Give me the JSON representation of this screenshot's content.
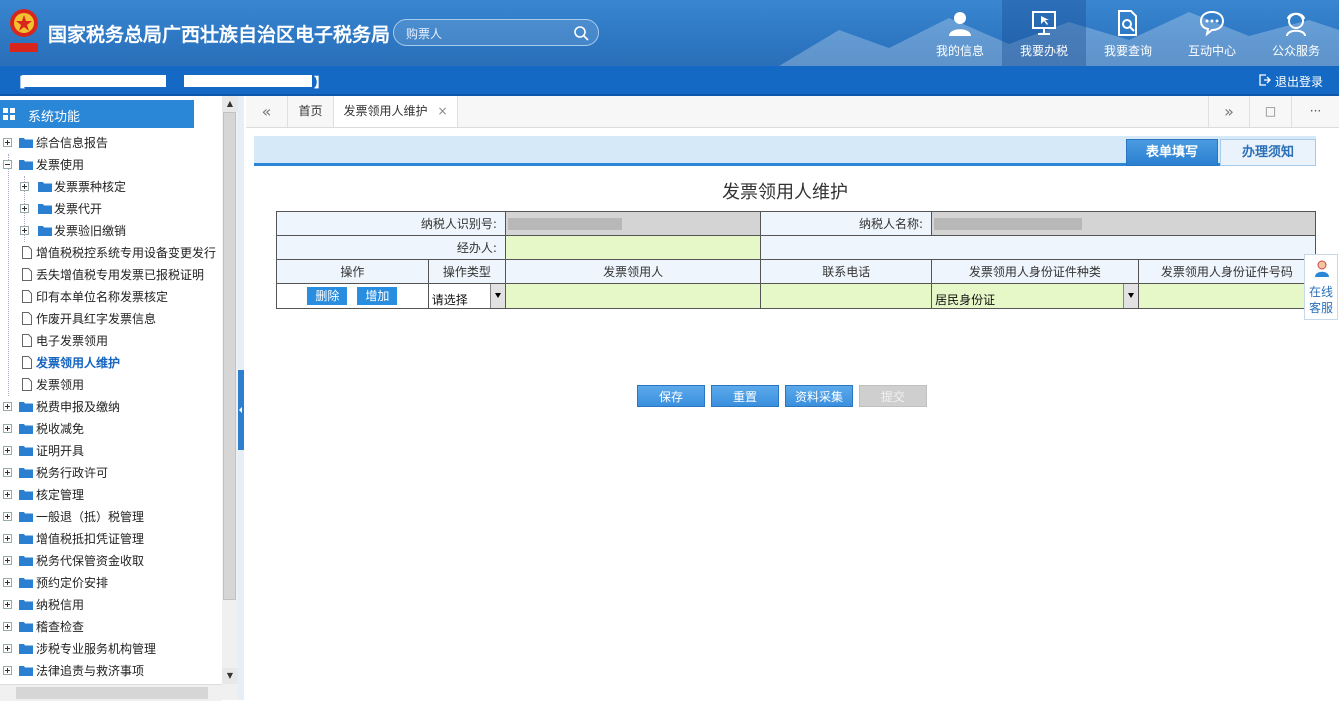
{
  "header": {
    "site_title": "国家税务总局广西壮族自治区电子税务局",
    "emblem_text": "中国税务",
    "search_placeholder": "购票人",
    "nav": [
      {
        "label": "我的信息",
        "icon": "user-icon"
      },
      {
        "label": "我要办税",
        "icon": "monitor-icon"
      },
      {
        "label": "我要查询",
        "icon": "document-search-icon"
      },
      {
        "label": "互动中心",
        "icon": "chat-icon"
      },
      {
        "label": "公众服务",
        "icon": "service-person-icon"
      }
    ]
  },
  "userbar": {
    "open_bracket": "【",
    "close_bracket": "】",
    "logout_label": "退出登录"
  },
  "sidebar": {
    "title": "系统功能",
    "items": [
      {
        "label": "综合信息报告"
      },
      {
        "label": "发票使用"
      },
      {
        "label": "发票票种核定"
      },
      {
        "label": "发票代开"
      },
      {
        "label": "发票验旧缴销"
      },
      {
        "label": "增值税税控系统专用设备变更发行"
      },
      {
        "label": "丢失增值税专用发票已报税证明"
      },
      {
        "label": "印有本单位名称发票核定"
      },
      {
        "label": "作废开具红字发票信息"
      },
      {
        "label": "电子发票领用"
      },
      {
        "label": "发票领用人维护"
      },
      {
        "label": "发票领用"
      },
      {
        "label": "税费申报及缴纳"
      },
      {
        "label": "税收减免"
      },
      {
        "label": "证明开具"
      },
      {
        "label": "税务行政许可"
      },
      {
        "label": "核定管理"
      },
      {
        "label": "一般退（抵）税管理"
      },
      {
        "label": "增值税抵扣凭证管理"
      },
      {
        "label": "税务代保管资金收取"
      },
      {
        "label": "预约定价安排"
      },
      {
        "label": "纳税信用"
      },
      {
        "label": "稽查检查"
      },
      {
        "label": "涉税专业服务机构管理"
      },
      {
        "label": "法律追责与救济事项"
      }
    ]
  },
  "tabs": {
    "home": "首页",
    "current": "发票领用人维护",
    "close": "×",
    "more": "···"
  },
  "content": {
    "tab_form": "表单填写",
    "tab_notice": "办理须知",
    "form_title": "发票领用人维护",
    "taxpayer_id_label": "纳税人识别号:",
    "taxpayer_name_label": "纳税人名称:",
    "agent_label": "经办人:",
    "columns": [
      "操作",
      "操作类型",
      "发票领用人",
      "联系电话",
      "发票领用人身份证件种类",
      "发票领用人身份证件号码"
    ],
    "delete_label": "删除",
    "add_label": "增加",
    "op_type_value": "请选择",
    "id_type_value": "居民身份证",
    "buttons": {
      "save": "保存",
      "reset": "重置",
      "collect": "资料采集",
      "submit": "提交"
    }
  },
  "float": {
    "line1": "在线",
    "line2": "客服"
  },
  "colors": {
    "header_blue": "#2e78c4",
    "userbar_blue": "#1469c4",
    "accent": "#2a86d6",
    "editable_green": "#e6f8c8",
    "readonly_gray": "#d4d4d4"
  }
}
